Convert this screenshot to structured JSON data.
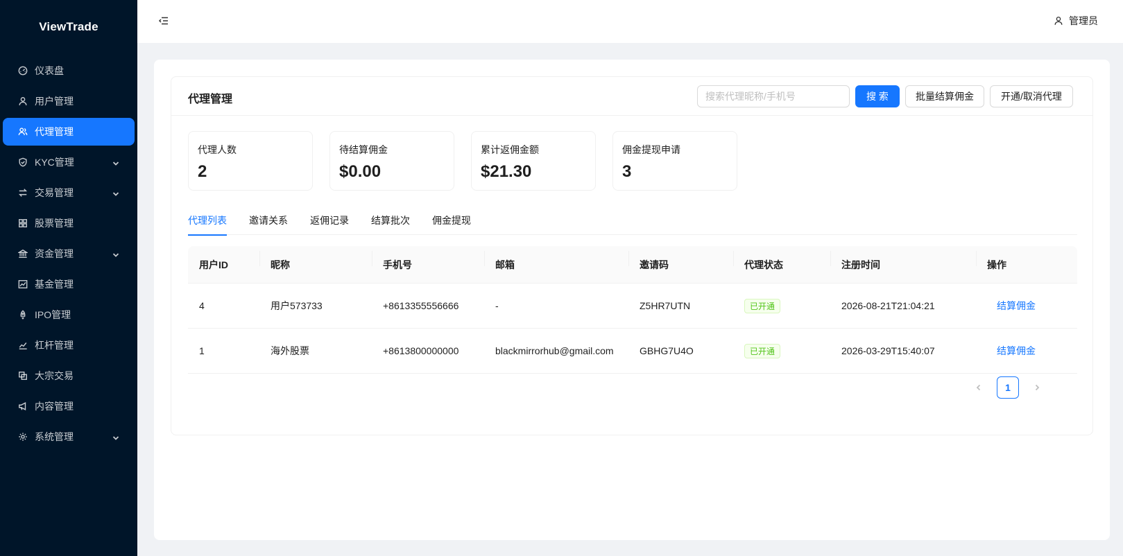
{
  "app": {
    "brand": "ViewTrade"
  },
  "sidebar": {
    "items": [
      {
        "label": "仪表盘",
        "icon": "dashboard-icon",
        "active": false,
        "expandable": false
      },
      {
        "label": "用户管理",
        "icon": "user-icon",
        "active": false,
        "expandable": false
      },
      {
        "label": "代理管理",
        "icon": "agent-icon",
        "active": true,
        "expandable": false
      },
      {
        "label": "KYC管理",
        "icon": "shield-check-icon",
        "active": false,
        "expandable": true
      },
      {
        "label": "交易管理",
        "icon": "swap-icon",
        "active": false,
        "expandable": true
      },
      {
        "label": "股票管理",
        "icon": "grid-icon",
        "active": false,
        "expandable": false
      },
      {
        "label": "资金管理",
        "icon": "bank-icon",
        "active": false,
        "expandable": true
      },
      {
        "label": "基金管理",
        "icon": "fund-chart-icon",
        "active": false,
        "expandable": false
      },
      {
        "label": "IPO管理",
        "icon": "rocket-icon",
        "active": false,
        "expandable": false
      },
      {
        "label": "杠杆管理",
        "icon": "line-chart-icon",
        "active": false,
        "expandable": false
      },
      {
        "label": "大宗交易",
        "icon": "block-icon",
        "active": false,
        "expandable": false
      },
      {
        "label": "内容管理",
        "icon": "megaphone-icon",
        "active": false,
        "expandable": false
      },
      {
        "label": "系统管理",
        "icon": "gear-icon",
        "active": false,
        "expandable": true
      }
    ]
  },
  "header": {
    "user_label": "管理员"
  },
  "card": {
    "title": "代理管理",
    "search_placeholder": "搜索代理昵称/手机号",
    "search_button": "搜 索",
    "batch_button": "批量结算佣金",
    "toggle_button": "开通/取消代理"
  },
  "stats": [
    {
      "label": "代理人数",
      "value": "2"
    },
    {
      "label": "待结算佣金",
      "value": "$0.00"
    },
    {
      "label": "累计返佣金额",
      "value": "$21.30"
    },
    {
      "label": "佣金提现申请",
      "value": "3"
    }
  ],
  "tabs": [
    {
      "label": "代理列表",
      "active": true
    },
    {
      "label": "邀请关系",
      "active": false
    },
    {
      "label": "返佣记录",
      "active": false
    },
    {
      "label": "结算批次",
      "active": false
    },
    {
      "label": "佣金提现",
      "active": false
    }
  ],
  "table": {
    "columns": [
      "用户ID",
      "昵称",
      "手机号",
      "邮箱",
      "邀请码",
      "代理状态",
      "注册时间",
      "操作"
    ],
    "rows": [
      {
        "id": "4",
        "nickname": "用户573733",
        "phone": "+8613355556666",
        "email": "-",
        "invite_code": "Z5HR7UTN",
        "status": "已开通",
        "registered": "2026-08-21T21:04:21",
        "action": "结算佣金"
      },
      {
        "id": "1",
        "nickname": "海外股票",
        "phone": "+8613800000000",
        "email": "blackmirrorhub@gmail.com",
        "invite_code": "GBHG7U4O",
        "status": "已开通",
        "registered": "2026-03-29T15:40:07",
        "action": "结算佣金"
      }
    ]
  },
  "pagination": {
    "current_page": "1"
  },
  "colors": {
    "primary": "#1677ff",
    "sidebar_bg": "#001529",
    "success": "#52c41a"
  }
}
